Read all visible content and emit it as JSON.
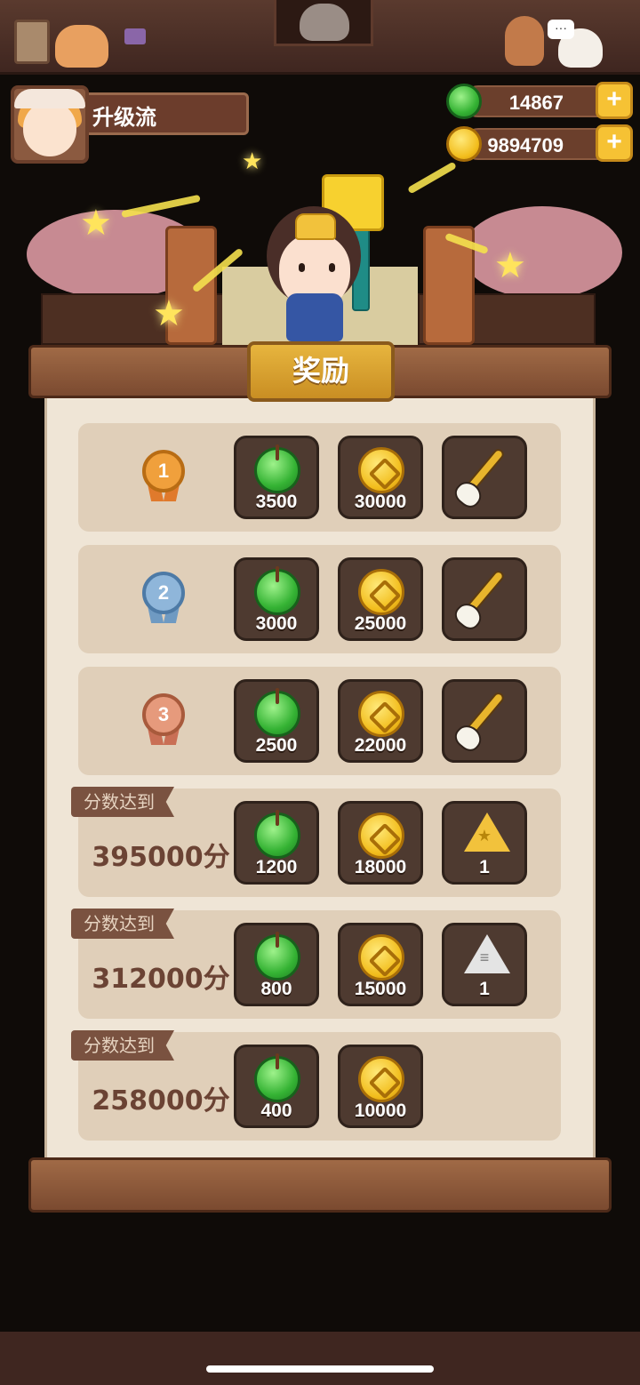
{
  "player": {
    "name": "升级流"
  },
  "currency": {
    "jade": "14867",
    "coins": "9894709",
    "plus": "+"
  },
  "panel": {
    "title": "奖励"
  },
  "rank_rewards": [
    {
      "rank": "1",
      "medal_color": "#f0a03c",
      "rewards": [
        {
          "type": "jade",
          "amount": "3500"
        },
        {
          "type": "coin",
          "amount": "30000"
        },
        {
          "type": "brush",
          "amount": ""
        }
      ]
    },
    {
      "rank": "2",
      "medal_color": "#8fb6da",
      "rewards": [
        {
          "type": "jade",
          "amount": "3000"
        },
        {
          "type": "coin",
          "amount": "25000"
        },
        {
          "type": "brush",
          "amount": ""
        }
      ]
    },
    {
      "rank": "3",
      "medal_color": "#e69a7c",
      "rewards": [
        {
          "type": "jade",
          "amount": "2500"
        },
        {
          "type": "coin",
          "amount": "22000"
        },
        {
          "type": "brush",
          "amount": ""
        }
      ]
    }
  ],
  "score_rewards": [
    {
      "tag": "分数达到",
      "score": "395000分",
      "rewards": [
        {
          "type": "jade",
          "amount": "1200"
        },
        {
          "type": "coin",
          "amount": "18000"
        },
        {
          "type": "gold-token",
          "amount": "1"
        }
      ]
    },
    {
      "tag": "分数达到",
      "score": "312000分",
      "rewards": [
        {
          "type": "jade",
          "amount": "800"
        },
        {
          "type": "coin",
          "amount": "15000"
        },
        {
          "type": "silver-token",
          "amount": "1"
        }
      ]
    },
    {
      "tag": "分数达到",
      "score": "258000分",
      "rewards": [
        {
          "type": "jade",
          "amount": "400"
        },
        {
          "type": "coin",
          "amount": "10000"
        }
      ]
    }
  ],
  "colors": {
    "panel_bg": "#efe5d6",
    "row_bg": "#e0cfb9",
    "slot_bg": "#4e3a30",
    "accent_gold": "#e7b53e"
  }
}
